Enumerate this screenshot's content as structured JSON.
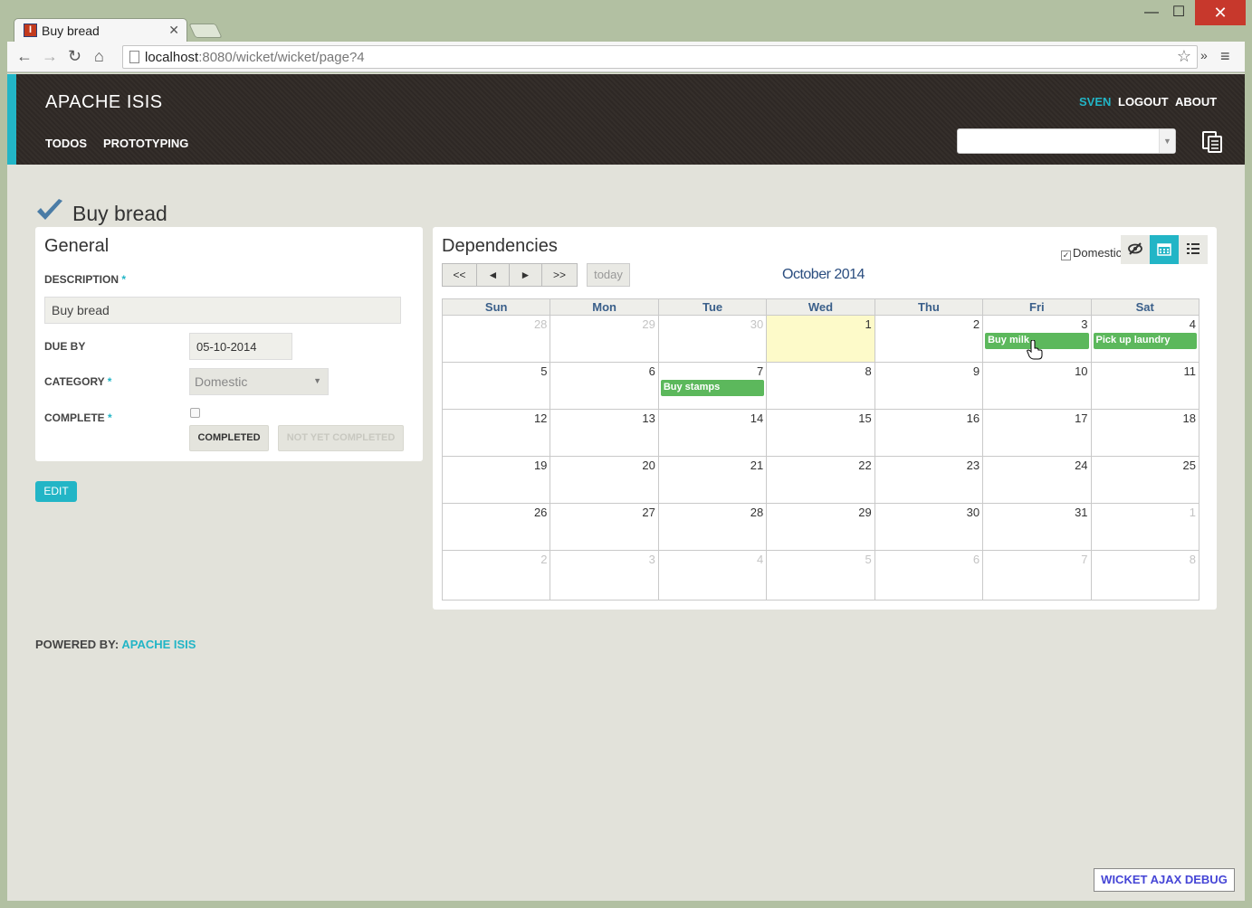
{
  "browser": {
    "tab_title": "Buy bread",
    "tab_icon": "isis-favicon",
    "url_host": "localhost",
    "url_rest": ":8080/wicket/wicket/page?4"
  },
  "header": {
    "brand": "APACHE ISIS",
    "user": "SVEN",
    "logout": "LOGOUT",
    "about": "ABOUT",
    "menus": [
      "TODOS",
      "PROTOTYPING"
    ],
    "accent_color": "#22b5c6"
  },
  "object": {
    "title": "Buy bread",
    "title_icon": "checkmark-icon"
  },
  "general": {
    "heading": "General",
    "description_label": "DESCRIPTION",
    "description_value": "Buy bread",
    "due_by_label": "DUE BY",
    "due_by_value": "05-10-2014",
    "category_label": "CATEGORY",
    "category_value": "Domestic",
    "complete_label": "COMPLETE",
    "complete_checked": false,
    "completed_button": "COMPLETED",
    "not_yet_completed_button": "NOT YET COMPLETED",
    "required_marker": "*"
  },
  "edit_button": "EDIT",
  "dependencies": {
    "heading": "Dependencies",
    "filter_label": "Domestic",
    "filter_checked": true,
    "calendar": {
      "nav": [
        "<<",
        "◄",
        "►",
        ">>"
      ],
      "today": "today",
      "title": "October 2014",
      "weekdays": [
        "Sun",
        "Mon",
        "Tue",
        "Wed",
        "Thu",
        "Fri",
        "Sat"
      ],
      "weeks": [
        [
          "28",
          "29",
          "30",
          "1",
          "2",
          "3",
          "4"
        ],
        [
          "5",
          "6",
          "7",
          "8",
          "9",
          "10",
          "11"
        ],
        [
          "12",
          "13",
          "14",
          "15",
          "16",
          "17",
          "18"
        ],
        [
          "19",
          "20",
          "21",
          "22",
          "23",
          "24",
          "25"
        ],
        [
          "26",
          "27",
          "28",
          "29",
          "30",
          "31",
          "1"
        ],
        [
          "2",
          "3",
          "4",
          "5",
          "6",
          "7",
          "8"
        ]
      ],
      "events": [
        {
          "title": "Buy milk",
          "date": "3"
        },
        {
          "title": "Pick up laundry",
          "date": "4"
        },
        {
          "title": "Buy stamps",
          "date": "7"
        }
      ],
      "today_date": "1",
      "event_color": "#5cb85c"
    }
  },
  "footer": {
    "powered_by": "POWERED BY:",
    "powered_link": "APACHE ISIS",
    "debug": "WICKET AJAX DEBUG"
  }
}
